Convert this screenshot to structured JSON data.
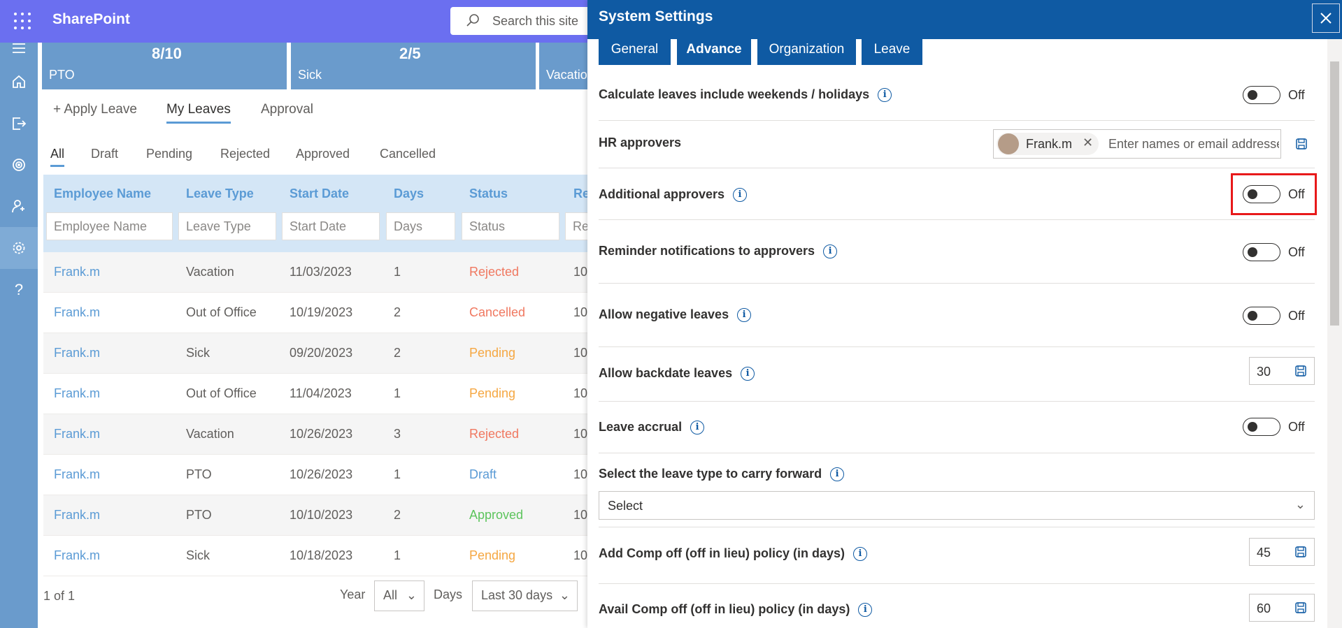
{
  "topbar": {
    "brand": "SharePoint",
    "search_placeholder": "Search this site"
  },
  "tiles": [
    {
      "value": "8/10",
      "label": "PTO"
    },
    {
      "value": "2/5",
      "label": "Sick"
    },
    {
      "value": "",
      "label": "Vacatio"
    }
  ],
  "main_tabs": {
    "apply": "Apply Leave",
    "my": "My Leaves",
    "approval": "Approval"
  },
  "status_tabs": [
    "All",
    "Draft",
    "Pending",
    "Rejected",
    "Approved",
    "Cancelled"
  ],
  "grid": {
    "headers": [
      "Employee Name",
      "Leave Type",
      "Start Date",
      "Days",
      "Status",
      "Re"
    ],
    "filters": [
      "Employee Name",
      "Leave Type",
      "Start Date",
      "Days",
      "Status",
      "Re"
    ],
    "rows": [
      {
        "name": "Frank.m",
        "type": "Vacation",
        "start": "11/03/2023",
        "days": "1",
        "status": "Rejected",
        "extra": "10"
      },
      {
        "name": "Frank.m",
        "type": "Out of Office",
        "start": "10/19/2023",
        "days": "2",
        "status": "Cancelled",
        "extra": "10"
      },
      {
        "name": "Frank.m",
        "type": "Sick",
        "start": "09/20/2023",
        "days": "2",
        "status": "Pending",
        "extra": "10"
      },
      {
        "name": "Frank.m",
        "type": "Out of Office",
        "start": "11/04/2023",
        "days": "1",
        "status": "Pending",
        "extra": "10"
      },
      {
        "name": "Frank.m",
        "type": "Vacation",
        "start": "10/26/2023",
        "days": "3",
        "status": "Rejected",
        "extra": "10"
      },
      {
        "name": "Frank.m",
        "type": "PTO",
        "start": "10/26/2023",
        "days": "1",
        "status": "Draft",
        "extra": "10"
      },
      {
        "name": "Frank.m",
        "type": "PTO",
        "start": "10/10/2023",
        "days": "2",
        "status": "Approved",
        "extra": "10"
      },
      {
        "name": "Frank.m",
        "type": "Sick",
        "start": "10/18/2023",
        "days": "1",
        "status": "Pending",
        "extra": "10"
      }
    ]
  },
  "footer": {
    "pager": "1 of 1",
    "year_label": "Year",
    "year_value": "All",
    "days_label": "Days",
    "days_value": "Last 30 days"
  },
  "status_colors": {
    "Rejected": "#f07860",
    "Cancelled": "#f07860",
    "Pending": "#f5a742",
    "Draft": "#5b9bd5",
    "Approved": "#5cc45c"
  },
  "panel": {
    "title": "System Settings",
    "tabs": [
      "General",
      "Advance",
      "Organization",
      "Leave"
    ],
    "selected_tab": "Advance",
    "settings": {
      "weekends": {
        "label": "Calculate leaves include weekends / holidays",
        "state": "Off"
      },
      "hr": {
        "label": "HR approvers",
        "person": "Frank.m",
        "placeholder": "Enter names or email addresses"
      },
      "additional": {
        "label": "Additional approvers",
        "state": "Off"
      },
      "reminder": {
        "label": "Reminder notifications to approvers",
        "state": "Off"
      },
      "negative": {
        "label": "Allow negative leaves",
        "state": "Off"
      },
      "backdate": {
        "label": "Allow backdate leaves",
        "value": "30"
      },
      "accrual": {
        "label": "Leave accrual",
        "state": "Off"
      },
      "carry": {
        "label": "Select the leave type to carry forward",
        "value": "Select"
      },
      "compoff_add": {
        "label": "Add Comp off (off in lieu) policy (in days)",
        "value": "45"
      },
      "compoff_avail": {
        "label": "Avail Comp off (off in lieu) policy (in days)",
        "value": "60"
      }
    }
  }
}
